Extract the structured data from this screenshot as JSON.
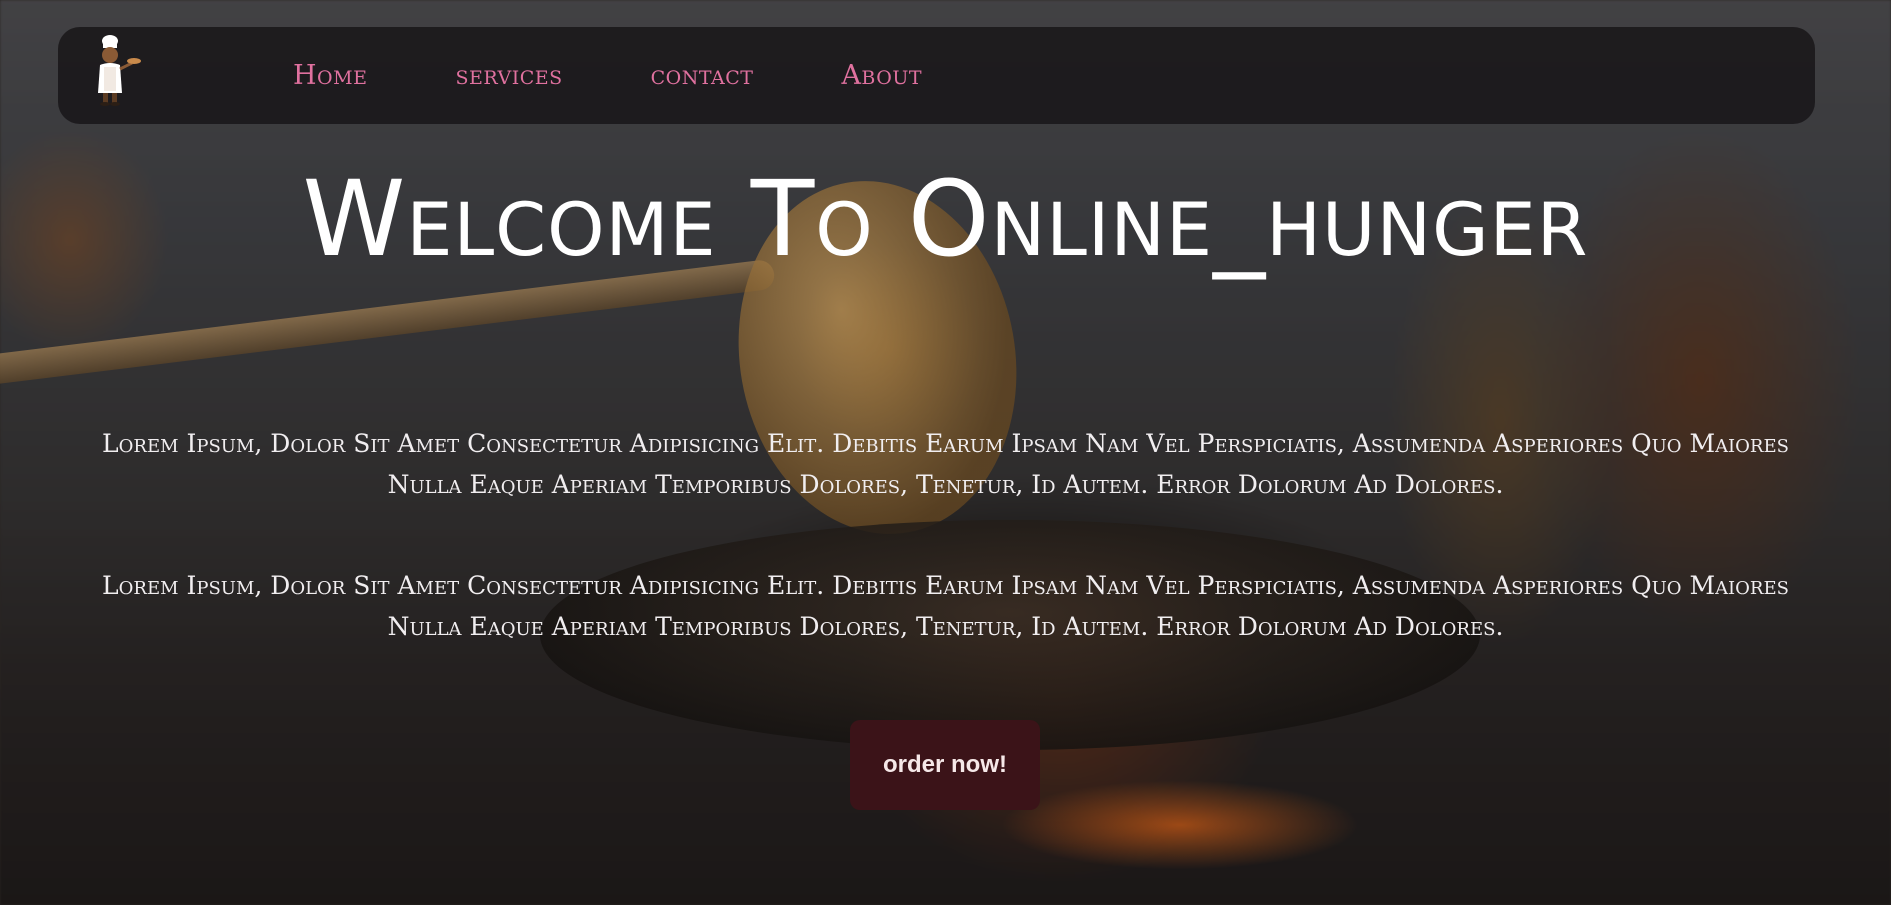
{
  "nav": {
    "logo_alt": "chef logo",
    "links": [
      {
        "label": "Home"
      },
      {
        "label": "services"
      },
      {
        "label": "contact"
      },
      {
        "label": "About"
      }
    ]
  },
  "hero": {
    "title": "Welcome To Online_hunger",
    "paragraphs": [
      "Lorem Ipsum, Dolor Sit Amet Consectetur Adipisicing Elit. Debitis Earum Ipsam Nam Vel Perspiciatis, Assumenda Asperiores Quo Maiores Nulla Eaque Aperiam Temporibus Dolores, Tenetur, Id Autem. Error Dolorum Ad Dolores.",
      "Lorem Ipsum, Dolor Sit Amet Consectetur Adipisicing Elit. Debitis Earum Ipsam Nam Vel Perspiciatis, Assumenda Asperiores Quo Maiores Nulla Eaque Aperiam Temporibus Dolores, Tenetur, Id Autem. Error Dolorum Ad Dolores."
    ],
    "cta_label": "order now!"
  },
  "colors": {
    "nav_link": "#e0719f",
    "cta_background": "#3b1318",
    "navbar_background": "#181618"
  },
  "icons": {
    "logo": "chef-icon"
  }
}
